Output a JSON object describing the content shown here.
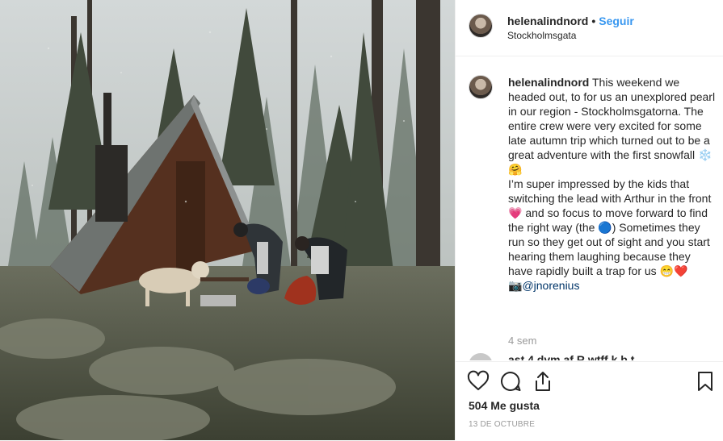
{
  "header": {
    "username": "helenalindnord",
    "separator": "•",
    "follow_label": "Seguir",
    "location": "Stockholmsgata"
  },
  "caption": {
    "username": "helenalindnord",
    "text": " This weekend we headed out, to for us an unexplored pearl in our region - Stockholmsgatorna. The entire crew were very excited for some late autumn trip which turned out to be a great adventure with the first snowfall ❄️ 🤗\nI’m super impressed by the kids that switching the lead with Arthur in the front 💗 and so focus to move forward to find the right way (the 🔵) Sometimes they run so they get out of sight and you start hearing them laughing because they have rapidly built a trap for us 😁❤️\n📷",
    "mention": "@jnorenius",
    "time_ago": "4 sem"
  },
  "next_comment": {
    "text": "ast.4.dvm.af.R.wtff.k.b.t"
  },
  "actions": {
    "like_icon": "heart-outline-icon",
    "comment_icon": "comment-bubble-icon",
    "share_icon": "share-upload-icon",
    "save_icon": "bookmark-outline-icon",
    "likes": "504 Me gusta",
    "date": "13 DE OCTUBRE"
  },
  "colors": {
    "follow_link": "#3897f0",
    "text": "#262626",
    "muted": "#999999",
    "border": "#efefef"
  }
}
